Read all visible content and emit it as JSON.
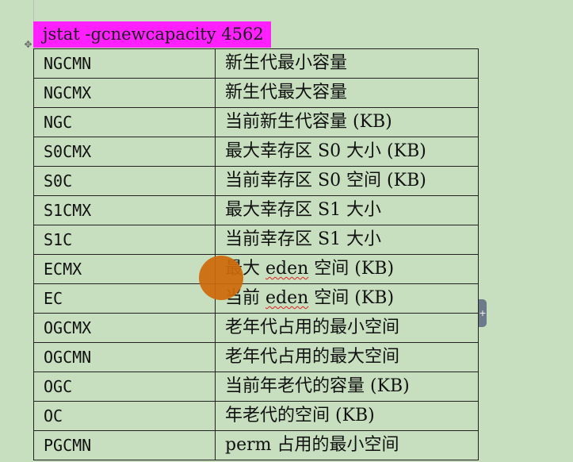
{
  "document": {
    "title": "jstat -gcnewcapacity 4562",
    "rows": [
      {
        "key": "NGCMN",
        "desc": "新生代最小容量"
      },
      {
        "key": "NGCMX",
        "desc": "新生代最大容量"
      },
      {
        "key": "NGC",
        "desc": "当前新生代容量 (KB)"
      },
      {
        "key": "S0CMX",
        "desc": "最大幸存区 S0 大小 (KB)"
      },
      {
        "key": "S0C",
        "desc": "当前幸存区 S0 空间 (KB)"
      },
      {
        "key": "S1CMX",
        "desc": "最大幸存区 S1 大小"
      },
      {
        "key": "S1C",
        "desc": "当前幸存区 S1 大小"
      },
      {
        "key": "ECMX",
        "desc": "最大 eden 空间 (KB)"
      },
      {
        "key": "EC",
        "desc": "当前 eden 空间 (KB)"
      },
      {
        "key": "OGCMX",
        "desc": "老年代占用的最小空间"
      },
      {
        "key": "OGCMN",
        "desc": "老年代占用的最大空间"
      },
      {
        "key": "OGC",
        "desc": "当前年老代的容量 (KB)"
      },
      {
        "key": "OC",
        "desc": "年老代的空间 (KB)"
      },
      {
        "key": "PGCMN",
        "desc": "perm 占用的最小空间"
      }
    ]
  },
  "ui": {
    "move_handle_icon": "move-arrows-icon",
    "side_tab_icon": "plus-icon",
    "side_tab_glyph": "+",
    "move_handle_glyph": "✥",
    "highlight_color": "#cd690a",
    "title_background": "#ff1fff",
    "page_background": "#c7dfbf"
  }
}
